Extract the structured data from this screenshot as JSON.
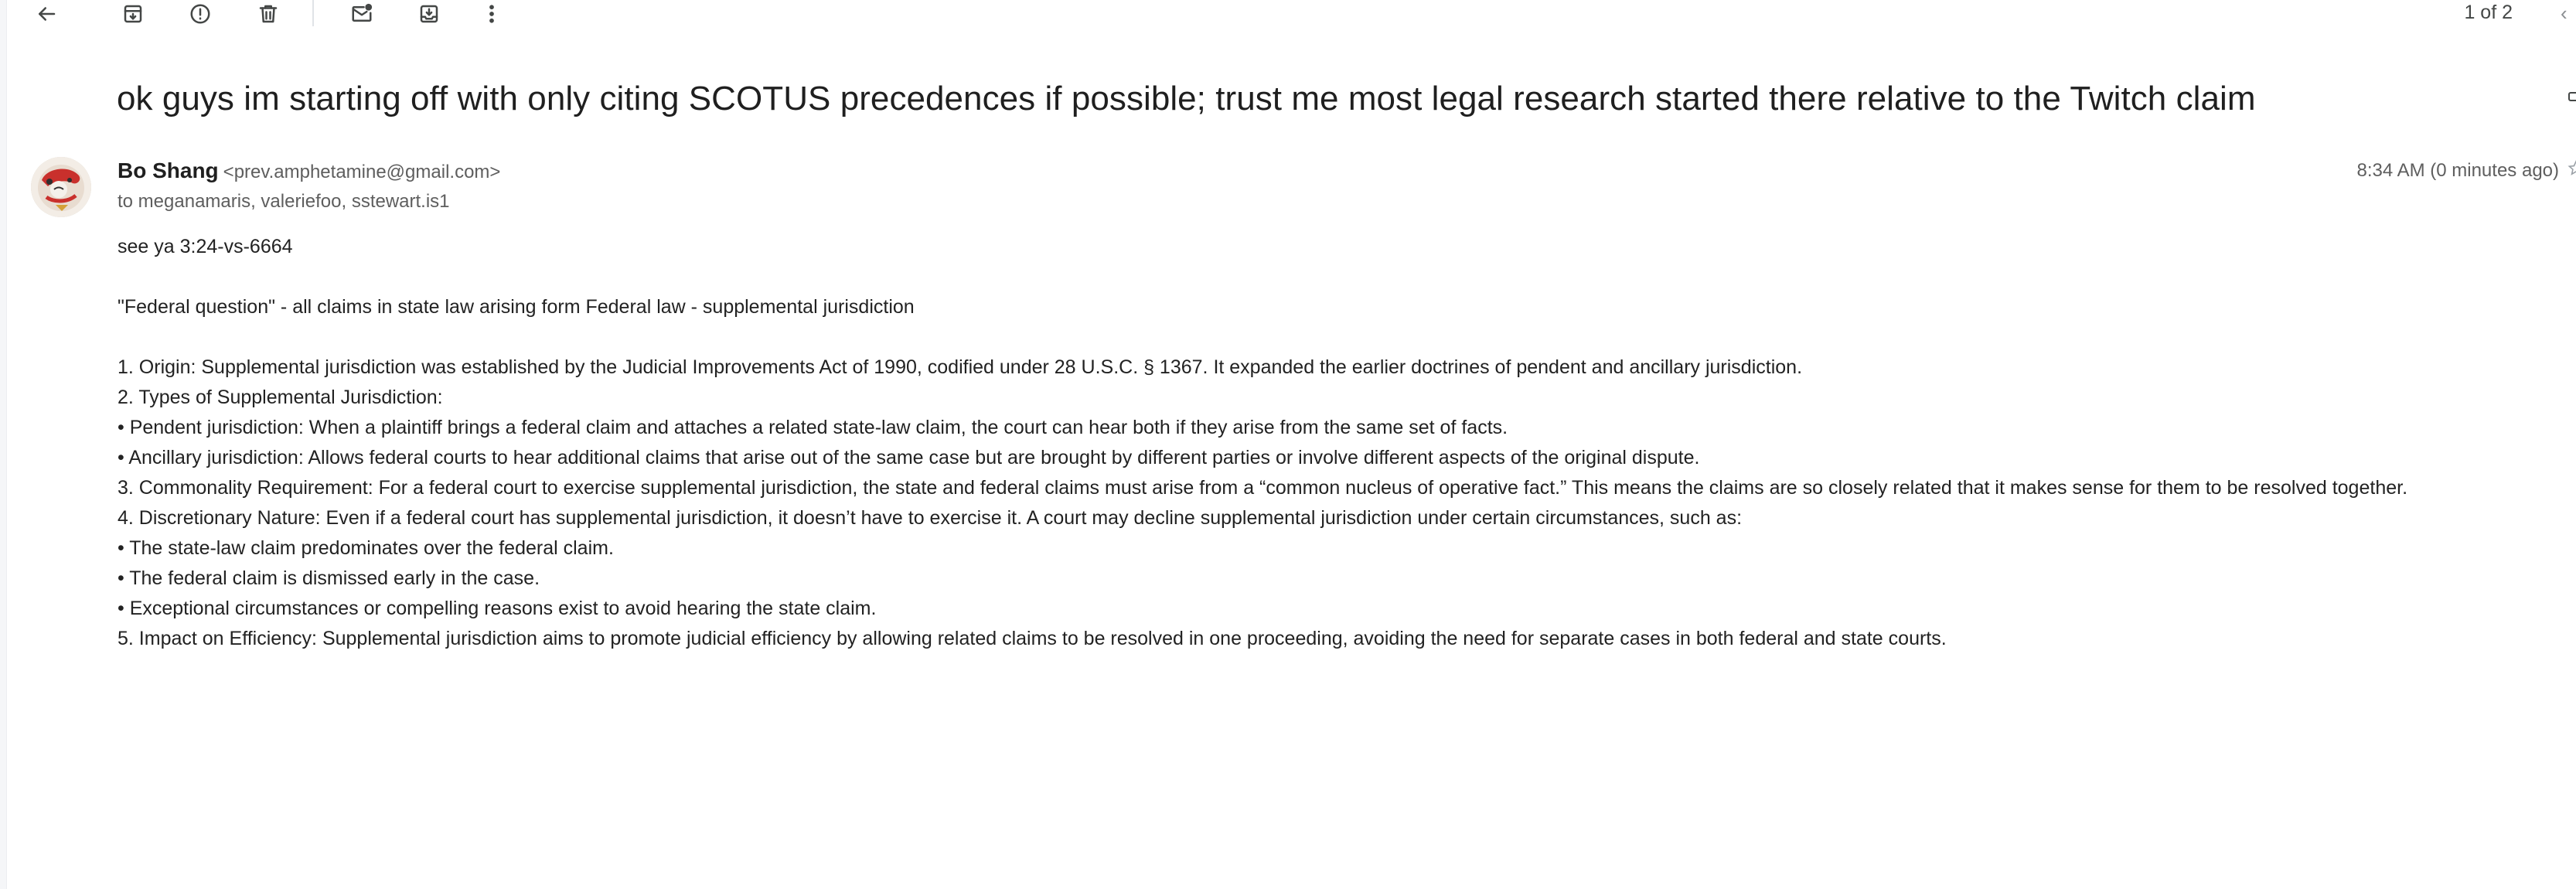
{
  "toolbar": {
    "pager": "1 of 2",
    "icons": [
      "back-icon",
      "archive-icon",
      "report-spam-icon",
      "delete-icon",
      "mark-unread-icon",
      "move-to-icon",
      "more-options-icon"
    ],
    "prev_glyph": "‹"
  },
  "message": {
    "subject": "ok guys im starting off with only citing SCOTUS precedences if possible; trust me most legal research started there relative to the Twitch claim",
    "sender_name": "Bo Shang",
    "sender_email": "<prev.amphetamine@gmail.com>",
    "recipients": "to meganamaris, valeriefoo, sstewart.is1",
    "timestamp": "8:34 AM (0 minutes ago)"
  },
  "body": {
    "greeting": "see ya 3:24-vs-6664",
    "intro": "\"Federal question\" - all claims in state law arising form Federal law - supplemental jurisdiction",
    "lines": [
      "1. Origin: Supplemental jurisdiction was established by the Judicial Improvements Act of 1990, codified under 28 U.S.C. § 1367. It expanded the earlier doctrines of pendent and ancillary jurisdiction.",
      "2. Types of Supplemental Jurisdiction:",
      "• Pendent jurisdiction: When a plaintiff brings a federal claim and attaches a related state-law claim, the court can hear both if they arise from the same set of facts.",
      "• Ancillary jurisdiction: Allows federal courts to hear additional claims that arise out of the same case but are brought by different parties or involve different aspects of the original dispute.",
      "3. Commonality Requirement: For a federal court to exercise supplemental jurisdiction, the state and federal claims must arise from a “common nucleus of operative fact.” This means the claims are so closely related that it makes sense for them to be resolved together.",
      "4. Discretionary Nature: Even if a federal court has supplemental jurisdiction, it doesn’t have to exercise it. A court may decline supplemental jurisdiction under certain circumstances, such as:",
      "• The state-law claim predominates over the federal claim.",
      "• The federal claim is dismissed early in the case.",
      "• Exceptional circumstances or compelling reasons exist to avoid hearing the state claim.",
      "5. Impact on Efficiency: Supplemental jurisdiction aims to promote judicial efficiency by allowing related claims to be resolved in one proceeding, avoiding the need for separate cases in both federal and state courts."
    ]
  },
  "colors": {
    "text_primary": "#1f1f1f",
    "text_secondary": "#5e5e5e",
    "icon": "#444746",
    "background": "#ffffff"
  }
}
